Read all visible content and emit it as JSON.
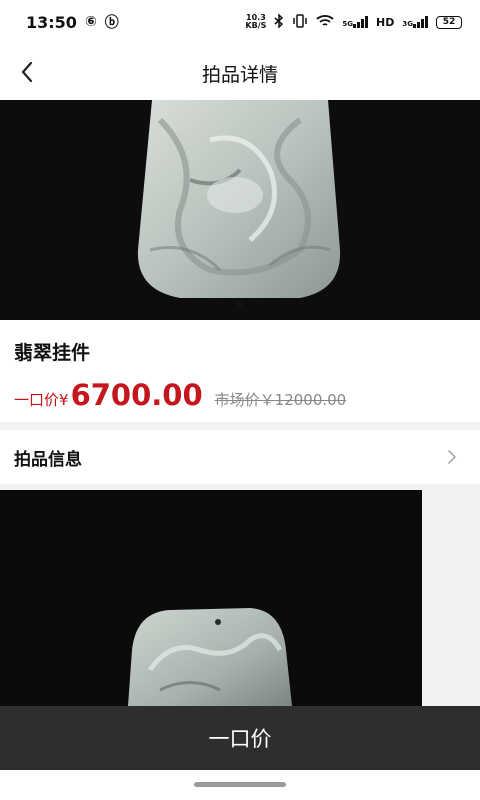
{
  "status_bar": {
    "time": "13:50",
    "app_icons": [
      "⑥",
      "ⓑ"
    ],
    "netspeed_value": "10.3",
    "netspeed_unit": "KB/S",
    "net_5g": "5G",
    "hd_label": "HD",
    "net_3g": "3G",
    "battery": "52"
  },
  "nav": {
    "title": "拍品详情"
  },
  "item": {
    "name": "翡翠挂件",
    "price_label": "一口价",
    "currency": "¥",
    "price": "6700.00",
    "market_price": "市场价￥12000.00"
  },
  "info": {
    "label": "拍品信息"
  },
  "buy_bar": {
    "label": "一口价"
  },
  "colors": {
    "accent": "#c4161c",
    "buy_bar_bg": "#2e2e2e"
  },
  "icons": [
    "back-arrow-icon",
    "chevron-right-icon",
    "wifi-icon",
    "bluetooth-icon",
    "vibrate-icon"
  ]
}
